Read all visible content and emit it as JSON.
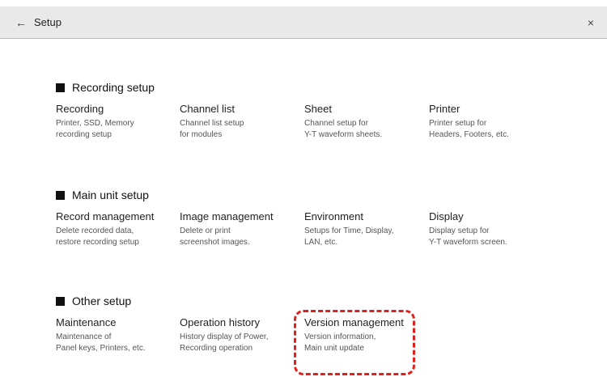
{
  "header": {
    "title": "Setup",
    "back_icon": "←",
    "close_icon": "×"
  },
  "sections": [
    {
      "title": "Recording setup",
      "items": [
        {
          "title": "Recording",
          "desc": "Printer, SSD, Memory\nrecording setup"
        },
        {
          "title": "Channel list",
          "desc": "Channel list setup\nfor modules"
        },
        {
          "title": "Sheet",
          "desc": "Channel setup for\nY-T waveform sheets."
        },
        {
          "title": "Printer",
          "desc": "Printer setup for\nHeaders, Footers, etc."
        }
      ]
    },
    {
      "title": "Main unit setup",
      "items": [
        {
          "title": "Record management",
          "desc": "Delete recorded data,\nrestore recording setup"
        },
        {
          "title": "Image management",
          "desc": "Delete or print\nscreenshot images."
        },
        {
          "title": "Environment",
          "desc": "Setups for Time, Display,\nLAN, etc."
        },
        {
          "title": "Display",
          "desc": "Display setup for\nY-T waveform screen."
        }
      ]
    },
    {
      "title": "Other setup",
      "items": [
        {
          "title": "Maintenance",
          "desc": "Maintenance of\nPanel keys, Printers, etc."
        },
        {
          "title": "Operation history",
          "desc": "History display of Power,\nRecording operation"
        },
        {
          "title": "Version management",
          "desc": "Version information,\nMain unit update"
        }
      ]
    }
  ],
  "colors": {
    "header_bg": "#e9e9e9",
    "highlight": "#e0201c"
  }
}
